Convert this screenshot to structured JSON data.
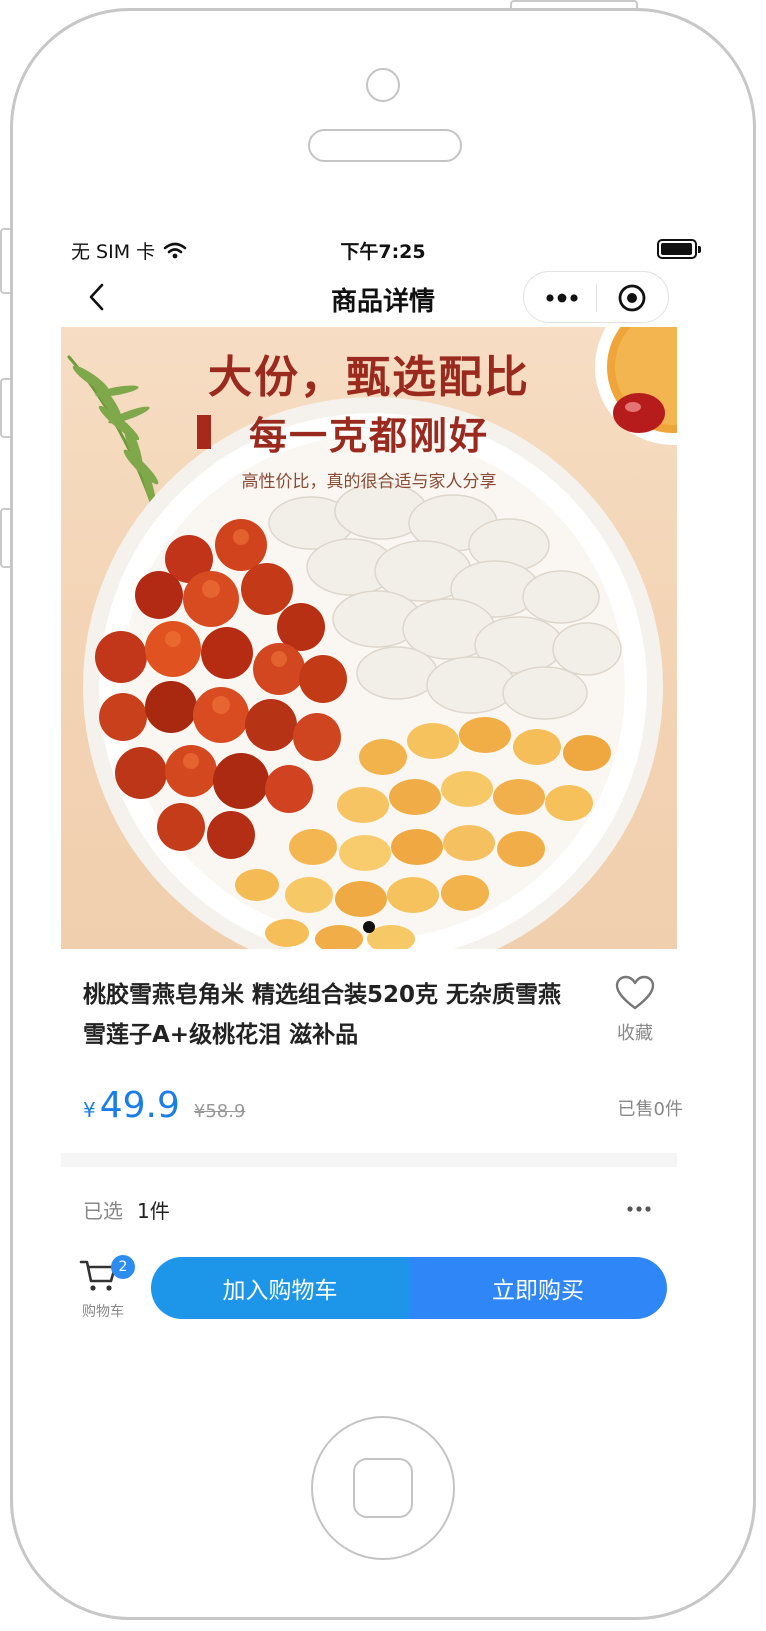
{
  "status_bar": {
    "carrier": "无 SIM 卡",
    "time": "下午7:25",
    "battery_level": 0.85
  },
  "nav": {
    "title": "商品详情"
  },
  "hero": {
    "banner_line1": "大份，甄选配比",
    "banner_line2": "每一克都刚好",
    "banner_line3": "高性价比，真的很合适与家人分享",
    "carousel_active_index": 0,
    "carousel_count": 1
  },
  "product": {
    "title": "桃胶雪燕皂角米 精选组合装520克 无杂质雪燕雪莲子A+级桃花泪 滋补品",
    "favorite_label": "收藏",
    "price_currency": "¥",
    "price": "49.9",
    "original_price": "¥58.9",
    "sold": "已售0件"
  },
  "spec": {
    "label": "已选",
    "value": "1件"
  },
  "actions": {
    "cart_label": "购物车",
    "cart_count": "2",
    "add_to_cart": "加入购物车",
    "buy_now": "立即购买"
  },
  "colors": {
    "accent_blue": "#1a7ee8",
    "add_button": "#1d96ea",
    "buy_button": "#2f86f6",
    "banner_red": "#9a2a1e"
  }
}
